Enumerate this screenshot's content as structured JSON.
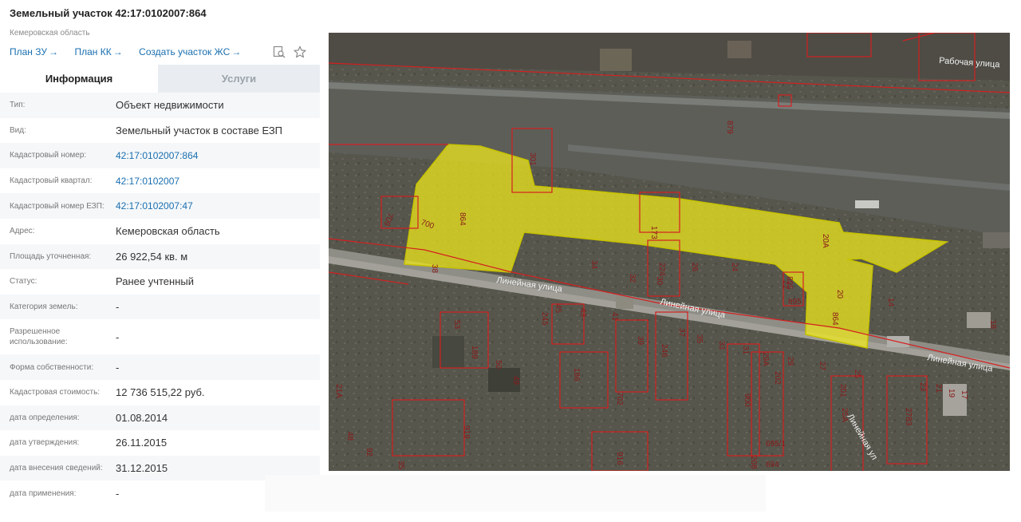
{
  "header": {
    "title": "Земельный участок 42:17:0102007:864",
    "subtitle": "Кемеровская область"
  },
  "links": [
    {
      "label": "План ЗУ",
      "arrow": "→"
    },
    {
      "label": "План КК",
      "arrow": "→"
    },
    {
      "label": "Создать участок ЖС",
      "arrow": "→"
    }
  ],
  "tools": {
    "icons": [
      "map-search-icon",
      "star-icon"
    ]
  },
  "tabs": [
    {
      "label": "Информация",
      "active": true
    },
    {
      "label": "Услуги",
      "active": false
    }
  ],
  "info": [
    {
      "label": "Тип:",
      "value": "Объект недвижимости"
    },
    {
      "label": "Вид:",
      "value": "Земельный участок в составе ЕЗП"
    },
    {
      "label": "Кадастровый номер:",
      "value": "42:17:0102007:864",
      "link": true
    },
    {
      "label": "Кадастровый квартал:",
      "value": "42:17:0102007",
      "link": true
    },
    {
      "label": "Кадастровый номер ЕЗП:",
      "value": "42:17:0102007:47",
      "link": true
    },
    {
      "label": "Адрес:",
      "value": "Кемеровская область"
    },
    {
      "label": "Площадь уточненная:",
      "value": "26 922,54 кв. м"
    },
    {
      "label": "Статус:",
      "value": "Ранее учтенный"
    },
    {
      "label": "Категория земель:",
      "value": "-"
    },
    {
      "label": "Разрешенное использование:",
      "value": "-"
    },
    {
      "label": "Форма собственности:",
      "value": "-"
    },
    {
      "label": "Кадастровая стоимость:",
      "value": "12 736 515,22 руб."
    },
    {
      "label": "дата определения:",
      "value": "01.08.2014"
    },
    {
      "label": "дата утверждения:",
      "value": "26.11.2015"
    },
    {
      "label": "дата внесения сведений:",
      "value": "31.12.2015"
    },
    {
      "label": "дата применения:",
      "value": "-"
    }
  ],
  "map": {
    "parcel_labels": [
      "864",
      "700",
      "38",
      "709",
      "301",
      "879",
      "173",
      "224",
      "20А",
      "895",
      "895",
      "864",
      "20",
      "22",
      "34",
      "30",
      "32",
      "26",
      "24",
      "245",
      "45",
      "43",
      "41",
      "39",
      "37",
      "35",
      "33",
      "31",
      "246",
      "186",
      "702",
      "919",
      "916",
      "189",
      "53",
      "50",
      "49",
      "29А",
      "29",
      "27",
      "25",
      "25А",
      "900",
      "202",
      "201",
      "695/1",
      "694",
      "208",
      "2783",
      "23",
      "21",
      "19",
      "17",
      "14",
      "18",
      "21А",
      "48",
      "92",
      "35"
    ],
    "street_labels": [
      "Линейная улица",
      "Линейная улица",
      "Линейная улица",
      "Рабочая улица",
      "Линейная ул"
    ],
    "colors": {
      "highlight": "#f2ec1b",
      "boundary": "#d42020",
      "label_text": "#8b1a1a"
    }
  }
}
